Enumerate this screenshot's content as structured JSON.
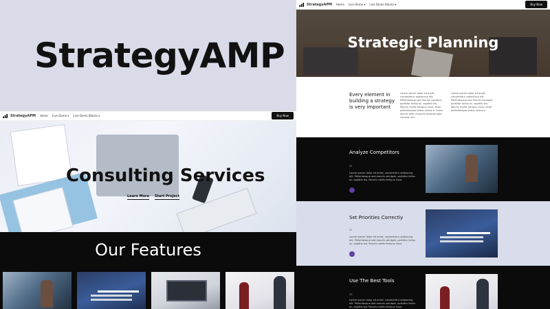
{
  "brand": {
    "title": "StrategyAMP"
  },
  "nav": {
    "logo_text": "StrategyAPM",
    "items": [
      "Home",
      "Live Demo ▾",
      "Live Demo Blocks ▾"
    ],
    "buy_label": "Buy Now"
  },
  "left": {
    "hero_title": "Consulting Services",
    "links": [
      "Learn More",
      "Start Project"
    ],
    "features_title": "Our Features"
  },
  "right": {
    "hero_title": "Strategic Planning",
    "intro_heading": "Every element in building a strategy is very important",
    "intro_col1": "Lorem ipsum dolor sit amet, consectetur adipiscing elit. Pellentesque sed mauris volutpat, porttitor tellus ac, sagittis leo. Mauris mollis tempus risus, vitae pellentesque libero luctus a. Fusce iaculis odio ut ipsum gravida odio congue nec.",
    "intro_col2": "Lorem ipsum dolor sit amet, consectetur adipiscing elit. Pellentesque sed mauris volutpat, porttitor tellus ac, sagittis leo. Mauris mollis tempus risus, vitae pellentesque libero luctus a.",
    "sections": [
      {
        "title": "Analyze Competitors",
        "num": "01",
        "text": "Lorem ipsum dolor sit amet, consectetur adipiscing elit. Pellentesque sed mauris volutpat, porttitor tellus ac, sagittis leo. Mauris mollis tempus risus.",
        "style": "dark"
      },
      {
        "title": "Set Priorities Correctly",
        "num": "02",
        "text": "Lorem ipsum dolor sit amet, consectetur adipiscing elit. Pellentesque sed mauris volutpat, porttitor tellus ac, sagittis leo. Mauris mollis tempus risus.",
        "style": "light"
      },
      {
        "title": "Use The Best Tools",
        "num": "03",
        "text": "Lorem ipsum dolor sit amet, consectetur adipiscing elit. Pellentesque sed mauris volutpat, porttitor tellus ac, sagittis leo. Mauris mollis tempus risus.",
        "style": "dark"
      }
    ]
  },
  "colors": {
    "background": "#d9dce8",
    "dark_section": "#0b0b0c",
    "light_section": "#d9dcea",
    "accent_dot": "#5b3a9b"
  }
}
